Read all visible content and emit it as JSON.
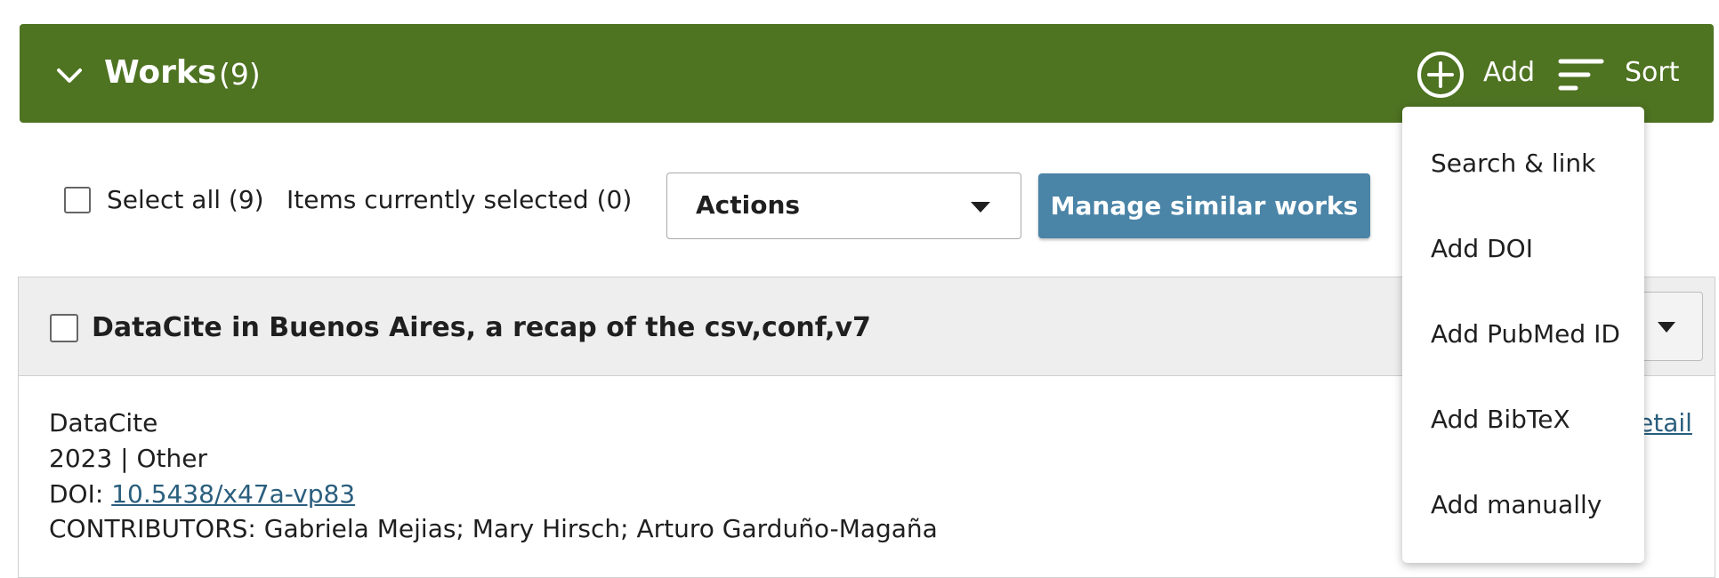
{
  "header": {
    "title": "Works",
    "count": "(9)",
    "add_label": "Add",
    "sort_label": "Sort",
    "background": "#4e7321"
  },
  "toolbar": {
    "select_all_label": "Select all (9)",
    "selected_text": "Items currently selected (0)",
    "actions_label": "Actions",
    "manage_label": "Manage similar works",
    "manage_color": "#4a84a7"
  },
  "work": {
    "title": "DataCite in Buenos Aires, a recap of the csv,conf,v7",
    "source": "DataCite",
    "date_type": "2023 | Other",
    "doi_prefix": "DOI: ",
    "doi": "10.5438/x47a-vp83",
    "contributors": "CONTRIBUTORS: Gabriela Mejias; Mary Hirsch; Arturo Garduño-Magaña",
    "detail_partial": "etail"
  },
  "add_menu": {
    "items": [
      "Search & link",
      "Add DOI",
      "Add PubMed ID",
      "Add BibTeX",
      "Add manually"
    ]
  },
  "icons": {
    "collapse": "chevron-down-icon",
    "add": "plus-circle-icon",
    "sort": "sort-lines-icon"
  }
}
